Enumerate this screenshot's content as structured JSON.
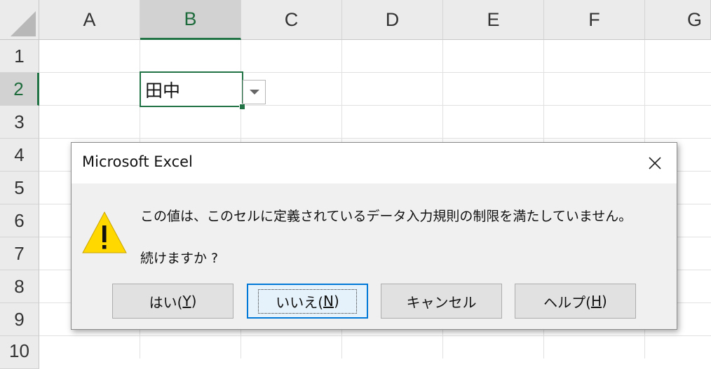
{
  "spreadsheet": {
    "columns": [
      "A",
      "B",
      "C",
      "D",
      "E",
      "F",
      "G"
    ],
    "rows": [
      "1",
      "2",
      "3",
      "4",
      "5",
      "6",
      "7",
      "8",
      "9",
      "10"
    ],
    "selected_column": "B",
    "selected_row": "2",
    "active_cell_value": "田中"
  },
  "dialog": {
    "title": "Microsoft Excel",
    "message_line1": "この値は、このセルに定義されているデータ入力規則の制限を満たしていません。",
    "message_line2": "続けますか ?",
    "buttons": [
      {
        "pre": "はい(",
        "key": "Y",
        "post": ")"
      },
      {
        "pre": "いいえ(",
        "key": "N",
        "post": ")"
      },
      {
        "pre": "キャンセル",
        "key": "",
        "post": ""
      },
      {
        "pre": "ヘルプ(",
        "key": "H",
        "post": ")"
      }
    ],
    "icon": "warning-icon",
    "colors": {
      "accent": "#0078d7",
      "warning": "#ffd800",
      "excel_green": "#217346"
    }
  }
}
